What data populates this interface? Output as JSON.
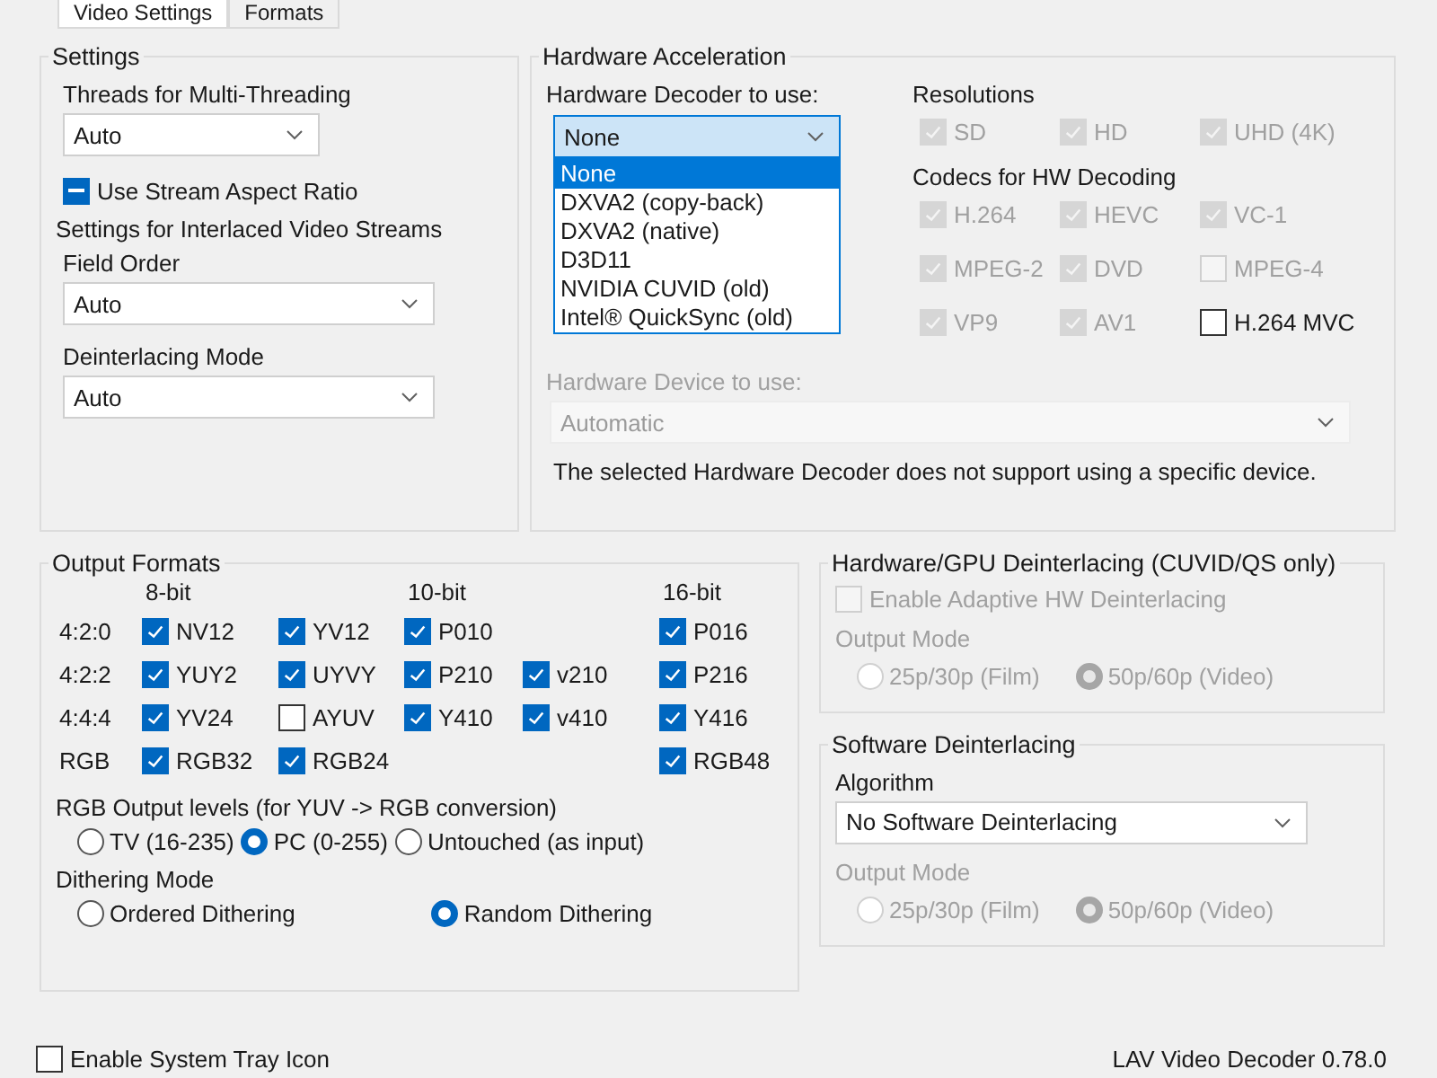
{
  "tabs": [
    {
      "label": "Video Settings",
      "selected": true
    },
    {
      "label": "Formats",
      "selected": false
    }
  ],
  "settings": {
    "title": "Settings",
    "threads": {
      "label": "Threads for Multi-Threading",
      "value": "Auto"
    },
    "aspect_ratio": {
      "label": "Use Stream Aspect Ratio",
      "checked": true,
      "mixed": true
    },
    "interlaced_title": "Settings for Interlaced Video Streams",
    "field_order": {
      "label": "Field Order",
      "value": "Auto"
    },
    "deinterlacing_mode": {
      "label": "Deinterlacing Mode",
      "value": "Auto"
    }
  },
  "hardware_acceleration": {
    "title": "Hardware Acceleration",
    "decoder": {
      "label": "Hardware Decoder to use:",
      "value": "None",
      "expanded": true,
      "options": [
        {
          "label": "None",
          "selected": true
        },
        {
          "label": "DXVA2 (copy-back)",
          "selected": false
        },
        {
          "label": "DXVA2 (native)",
          "selected": false
        },
        {
          "label": "D3D11",
          "selected": false
        },
        {
          "label": "NVIDIA CUVID (old)",
          "selected": false
        },
        {
          "label": "Intel® QuickSync (old)",
          "selected": false
        }
      ]
    },
    "device": {
      "label": "Hardware Device to use:",
      "value": "Automatic",
      "disabled": true
    },
    "note": "The selected Hardware Decoder does not support using a specific device.",
    "resolutions": {
      "title": "Resolutions",
      "items": [
        {
          "label": "SD",
          "checked": true,
          "disabled": true
        },
        {
          "label": "HD",
          "checked": true,
          "disabled": true
        },
        {
          "label": "UHD (4K)",
          "checked": true,
          "disabled": true
        }
      ]
    },
    "codecs": {
      "title": "Codecs for HW Decoding",
      "items": [
        {
          "label": "H.264",
          "checked": true,
          "disabled": true
        },
        {
          "label": "HEVC",
          "checked": true,
          "disabled": true
        },
        {
          "label": "VC-1",
          "checked": true,
          "disabled": true
        },
        {
          "label": "MPEG-2",
          "checked": true,
          "disabled": true
        },
        {
          "label": "DVD",
          "checked": true,
          "disabled": true
        },
        {
          "label": "MPEG-4",
          "checked": false,
          "disabled": true
        },
        {
          "label": "VP9",
          "checked": true,
          "disabled": true
        },
        {
          "label": "AV1",
          "checked": true,
          "disabled": true
        },
        {
          "label": "H.264 MVC",
          "checked": false,
          "disabled": false
        }
      ]
    }
  },
  "output_formats": {
    "title": "Output Formats",
    "column_headers": [
      {
        "label": "8-bit"
      },
      {
        "label": "10-bit"
      },
      {
        "label": "16-bit"
      }
    ],
    "rows": [
      {
        "label": "4:2:0",
        "cells": [
          {
            "label": "NV12",
            "checked": true
          },
          {
            "label": "YV12",
            "checked": true
          },
          {
            "label": "P010",
            "checked": true
          },
          null,
          {
            "label": "P016",
            "checked": true
          }
        ]
      },
      {
        "label": "4:2:2",
        "cells": [
          {
            "label": "YUY2",
            "checked": true
          },
          {
            "label": "UYVY",
            "checked": true
          },
          {
            "label": "P210",
            "checked": true
          },
          {
            "label": "v210",
            "checked": true
          },
          {
            "label": "P216",
            "checked": true
          }
        ]
      },
      {
        "label": "4:4:4",
        "cells": [
          {
            "label": "YV24",
            "checked": true
          },
          {
            "label": "AYUV",
            "checked": false
          },
          {
            "label": "Y410",
            "checked": true
          },
          {
            "label": "v410",
            "checked": true
          },
          {
            "label": "Y416",
            "checked": true
          }
        ]
      },
      {
        "label": "RGB",
        "cells": [
          {
            "label": "RGB32",
            "checked": true
          },
          {
            "label": "RGB24",
            "checked": true
          },
          null,
          null,
          {
            "label": "RGB48",
            "checked": true
          }
        ]
      }
    ],
    "rgb_levels": {
      "label": "RGB Output levels (for YUV -> RGB conversion)",
      "options": [
        {
          "label": "TV (16-235)",
          "selected": false
        },
        {
          "label": "PC (0-255)",
          "selected": true
        },
        {
          "label": "Untouched (as input)",
          "selected": false
        }
      ]
    },
    "dithering": {
      "label": "Dithering Mode",
      "options": [
        {
          "label": "Ordered Dithering",
          "selected": false
        },
        {
          "label": "Random Dithering",
          "selected": true
        }
      ]
    }
  },
  "hw_deinterlacing": {
    "title": "Hardware/GPU Deinterlacing (CUVID/QS only)",
    "adaptive": {
      "label": "Enable Adaptive HW Deinterlacing",
      "checked": false,
      "disabled": true
    },
    "output_mode": {
      "label": "Output Mode",
      "disabled": true,
      "options": [
        {
          "label": "25p/30p (Film)",
          "selected": false
        },
        {
          "label": "50p/60p (Video)",
          "selected": true
        }
      ]
    }
  },
  "sw_deinterlacing": {
    "title": "Software Deinterlacing",
    "algorithm": {
      "label": "Algorithm",
      "value": "No Software Deinterlacing"
    },
    "output_mode": {
      "label": "Output Mode",
      "disabled": true,
      "options": [
        {
          "label": "25p/30p (Film)",
          "selected": false
        },
        {
          "label": "50p/60p (Video)",
          "selected": true
        }
      ]
    }
  },
  "system_tray": {
    "label": "Enable System Tray Icon",
    "checked": false
  },
  "version": "LAV Video Decoder 0.78.0"
}
